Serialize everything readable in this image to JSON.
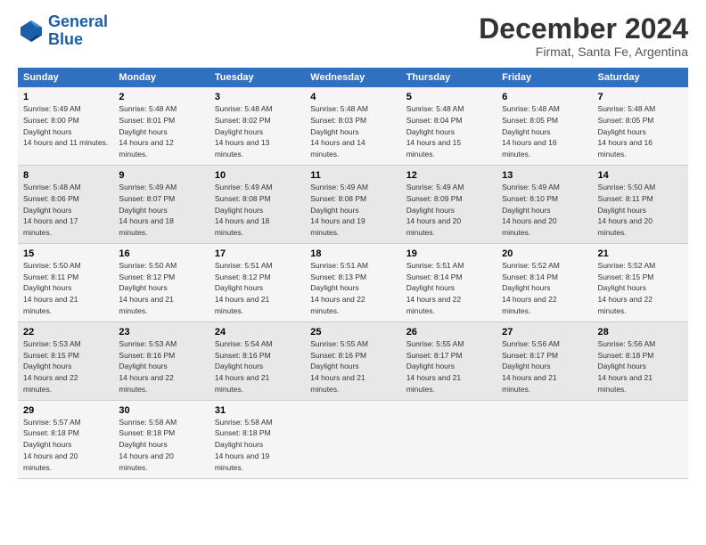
{
  "logo": {
    "line1": "General",
    "line2": "Blue"
  },
  "title": "December 2024",
  "subtitle": "Firmat, Santa Fe, Argentina",
  "days_header": [
    "Sunday",
    "Monday",
    "Tuesday",
    "Wednesday",
    "Thursday",
    "Friday",
    "Saturday"
  ],
  "weeks": [
    [
      {
        "day": "1",
        "rise": "5:49 AM",
        "set": "8:00 PM",
        "hours": "14 hours and 11 minutes."
      },
      {
        "day": "2",
        "rise": "5:48 AM",
        "set": "8:01 PM",
        "hours": "14 hours and 12 minutes."
      },
      {
        "day": "3",
        "rise": "5:48 AM",
        "set": "8:02 PM",
        "hours": "14 hours and 13 minutes."
      },
      {
        "day": "4",
        "rise": "5:48 AM",
        "set": "8:03 PM",
        "hours": "14 hours and 14 minutes."
      },
      {
        "day": "5",
        "rise": "5:48 AM",
        "set": "8:04 PM",
        "hours": "14 hours and 15 minutes."
      },
      {
        "day": "6",
        "rise": "5:48 AM",
        "set": "8:05 PM",
        "hours": "14 hours and 16 minutes."
      },
      {
        "day": "7",
        "rise": "5:48 AM",
        "set": "8:05 PM",
        "hours": "14 hours and 16 minutes."
      }
    ],
    [
      {
        "day": "8",
        "rise": "5:48 AM",
        "set": "8:06 PM",
        "hours": "14 hours and 17 minutes."
      },
      {
        "day": "9",
        "rise": "5:49 AM",
        "set": "8:07 PM",
        "hours": "14 hours and 18 minutes."
      },
      {
        "day": "10",
        "rise": "5:49 AM",
        "set": "8:08 PM",
        "hours": "14 hours and 18 minutes."
      },
      {
        "day": "11",
        "rise": "5:49 AM",
        "set": "8:08 PM",
        "hours": "14 hours and 19 minutes."
      },
      {
        "day": "12",
        "rise": "5:49 AM",
        "set": "8:09 PM",
        "hours": "14 hours and 20 minutes."
      },
      {
        "day": "13",
        "rise": "5:49 AM",
        "set": "8:10 PM",
        "hours": "14 hours and 20 minutes."
      },
      {
        "day": "14",
        "rise": "5:50 AM",
        "set": "8:11 PM",
        "hours": "14 hours and 20 minutes."
      }
    ],
    [
      {
        "day": "15",
        "rise": "5:50 AM",
        "set": "8:11 PM",
        "hours": "14 hours and 21 minutes."
      },
      {
        "day": "16",
        "rise": "5:50 AM",
        "set": "8:12 PM",
        "hours": "14 hours and 21 minutes."
      },
      {
        "day": "17",
        "rise": "5:51 AM",
        "set": "8:12 PM",
        "hours": "14 hours and 21 minutes."
      },
      {
        "day": "18",
        "rise": "5:51 AM",
        "set": "8:13 PM",
        "hours": "14 hours and 22 minutes."
      },
      {
        "day": "19",
        "rise": "5:51 AM",
        "set": "8:14 PM",
        "hours": "14 hours and 22 minutes."
      },
      {
        "day": "20",
        "rise": "5:52 AM",
        "set": "8:14 PM",
        "hours": "14 hours and 22 minutes."
      },
      {
        "day": "21",
        "rise": "5:52 AM",
        "set": "8:15 PM",
        "hours": "14 hours and 22 minutes."
      }
    ],
    [
      {
        "day": "22",
        "rise": "5:53 AM",
        "set": "8:15 PM",
        "hours": "14 hours and 22 minutes."
      },
      {
        "day": "23",
        "rise": "5:53 AM",
        "set": "8:16 PM",
        "hours": "14 hours and 22 minutes."
      },
      {
        "day": "24",
        "rise": "5:54 AM",
        "set": "8:16 PM",
        "hours": "14 hours and 21 minutes."
      },
      {
        "day": "25",
        "rise": "5:55 AM",
        "set": "8:16 PM",
        "hours": "14 hours and 21 minutes."
      },
      {
        "day": "26",
        "rise": "5:55 AM",
        "set": "8:17 PM",
        "hours": "14 hours and 21 minutes."
      },
      {
        "day": "27",
        "rise": "5:56 AM",
        "set": "8:17 PM",
        "hours": "14 hours and 21 minutes."
      },
      {
        "day": "28",
        "rise": "5:56 AM",
        "set": "8:18 PM",
        "hours": "14 hours and 21 minutes."
      }
    ],
    [
      {
        "day": "29",
        "rise": "5:57 AM",
        "set": "8:18 PM",
        "hours": "14 hours and 20 minutes."
      },
      {
        "day": "30",
        "rise": "5:58 AM",
        "set": "8:18 PM",
        "hours": "14 hours and 20 minutes."
      },
      {
        "day": "31",
        "rise": "5:58 AM",
        "set": "8:18 PM",
        "hours": "14 hours and 19 minutes."
      },
      null,
      null,
      null,
      null
    ]
  ]
}
